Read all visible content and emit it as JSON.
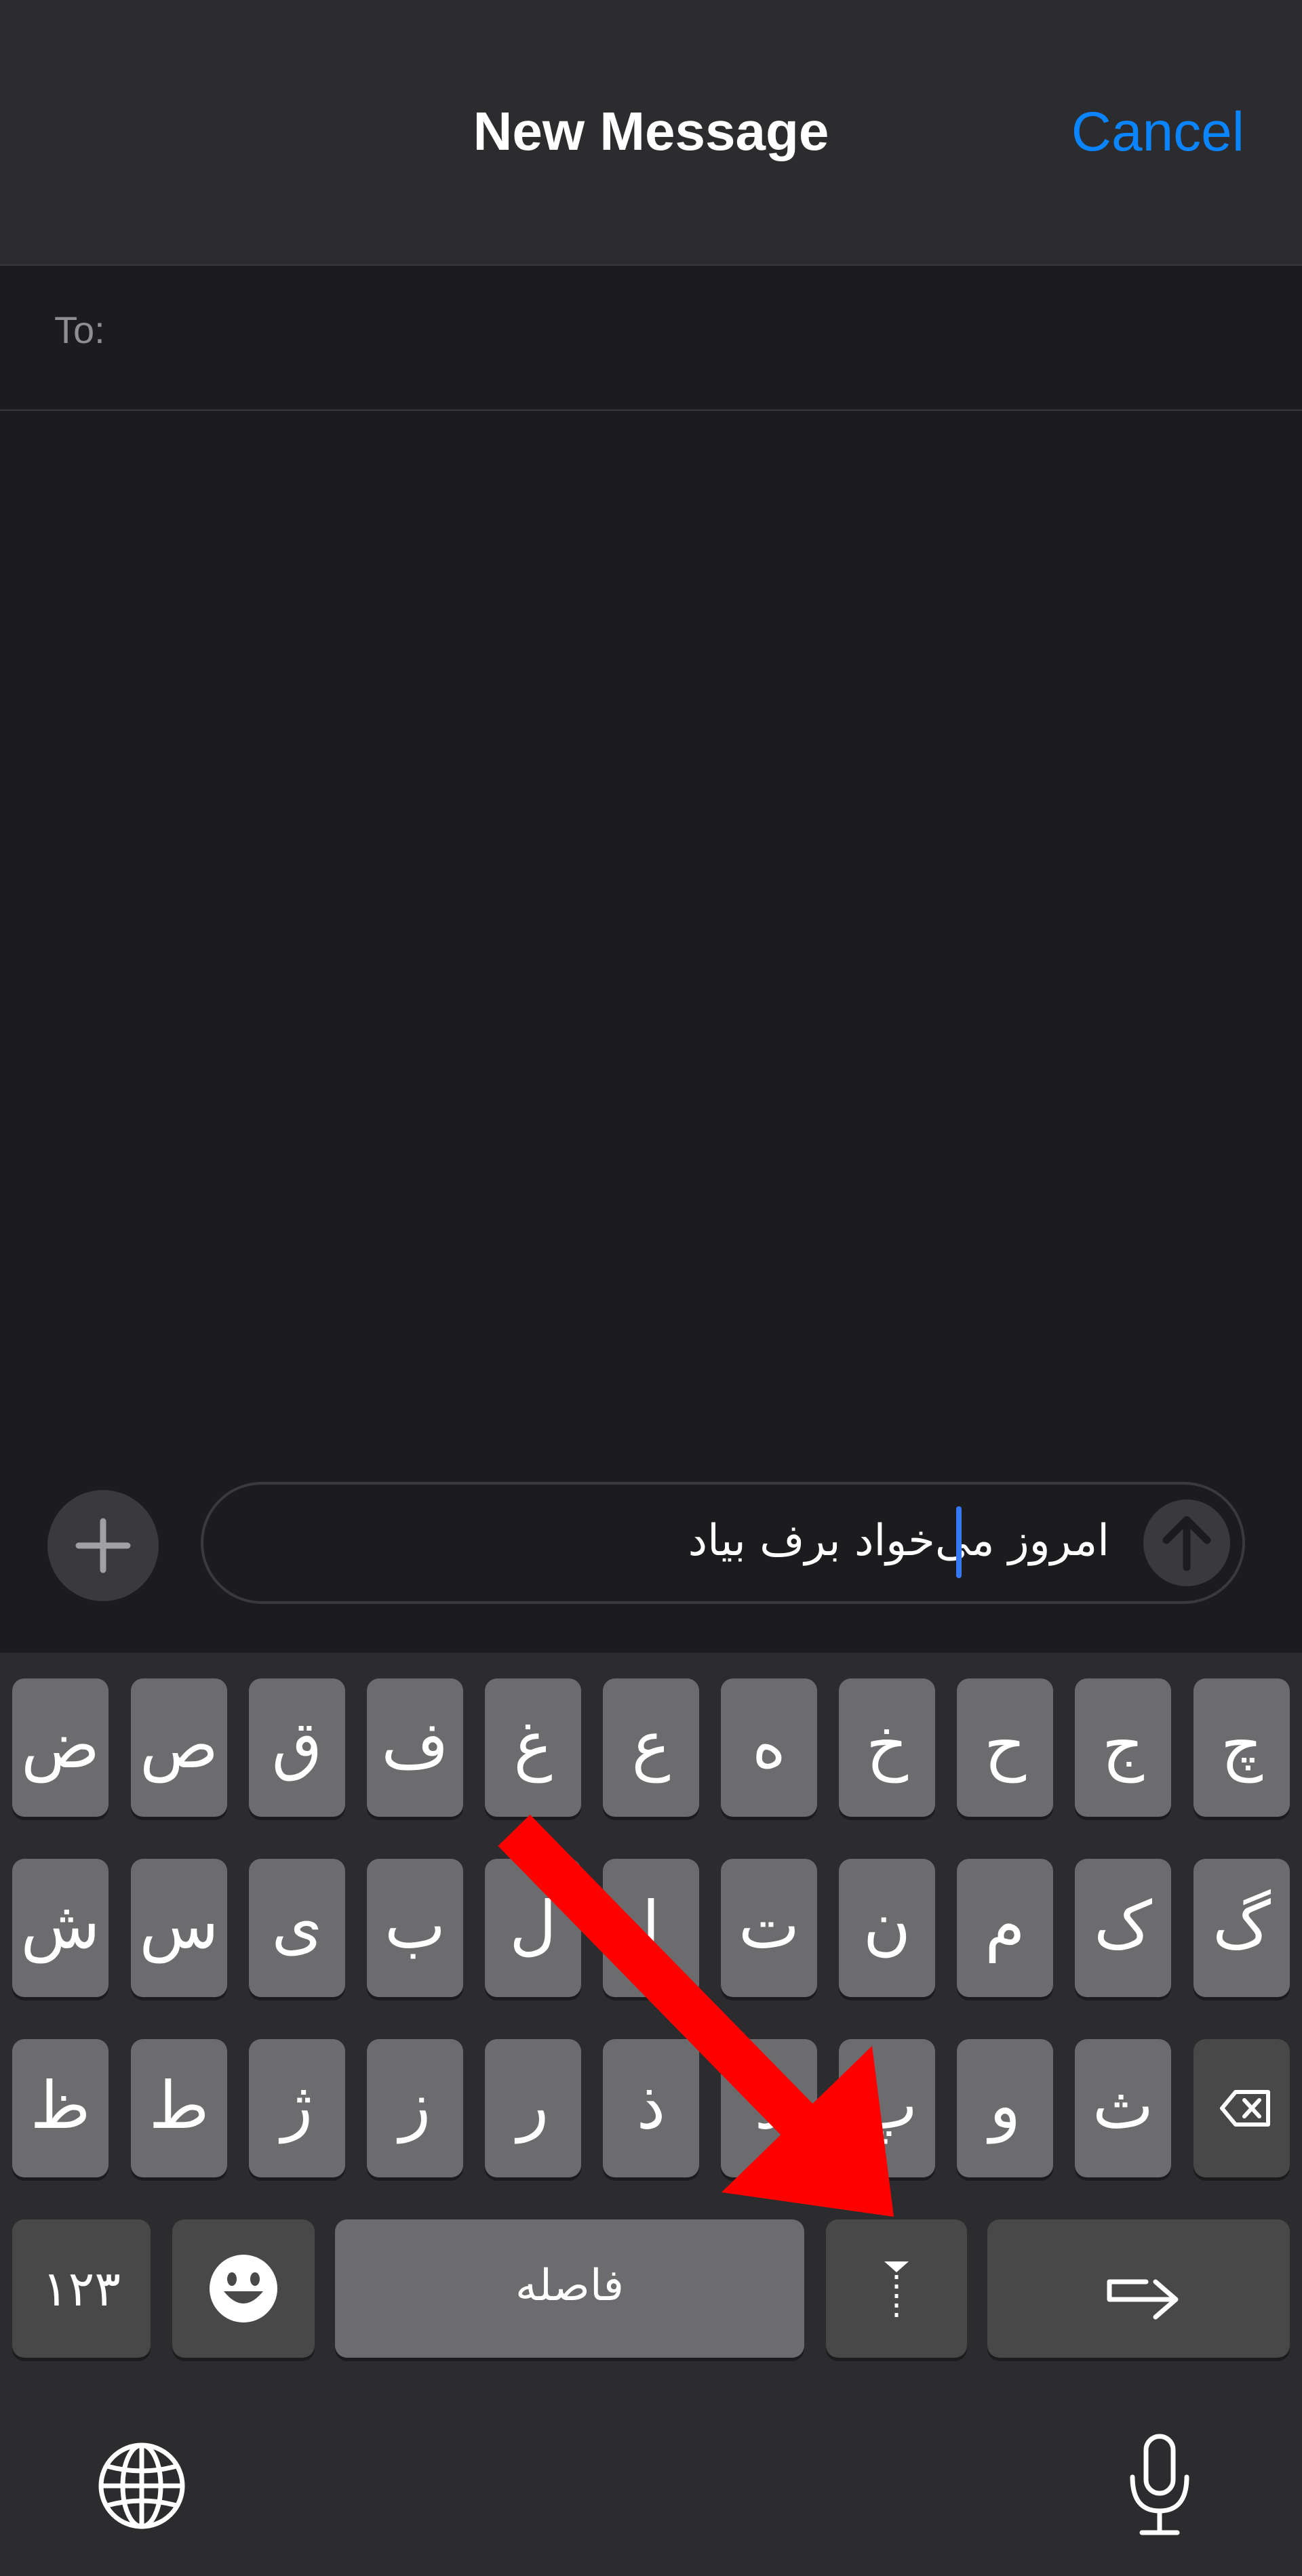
{
  "header": {
    "title": "New Message",
    "cancel_label": "Cancel"
  },
  "to_field": {
    "label": "To:"
  },
  "composer": {
    "text": "امروز می‌خواد برف بیاد"
  },
  "keyboard": {
    "row1": [
      "چ",
      "ج",
      "ح",
      "خ",
      "ه",
      "ع",
      "غ",
      "ف",
      "ق",
      "ص",
      "ض"
    ],
    "row2": [
      "گ",
      "ک",
      "م",
      "ن",
      "ت",
      "ا",
      "ل",
      "ب",
      "ی",
      "س",
      "ش"
    ],
    "row3": [
      "ث",
      "و",
      "پ",
      "د",
      "ذ",
      "ر",
      "ز",
      "ژ",
      "ط",
      "ظ"
    ],
    "numbers_label": "۱۲۳",
    "space_label": "فاصله"
  },
  "icons": {
    "plus": "plus-icon",
    "send": "arrow-up-icon",
    "delete": "delete-backward-icon",
    "emoji": "emoji-icon",
    "return": "return-icon",
    "zwnj": "zero-width-non-joiner-icon",
    "globe": "globe-icon",
    "mic": "microphone-icon",
    "annotation": "red-arrow-annotation"
  },
  "colors": {
    "accent": "#0a84ff",
    "caret": "#3478f6",
    "key": "#6c6c6e",
    "annotation": "#ff0000"
  }
}
